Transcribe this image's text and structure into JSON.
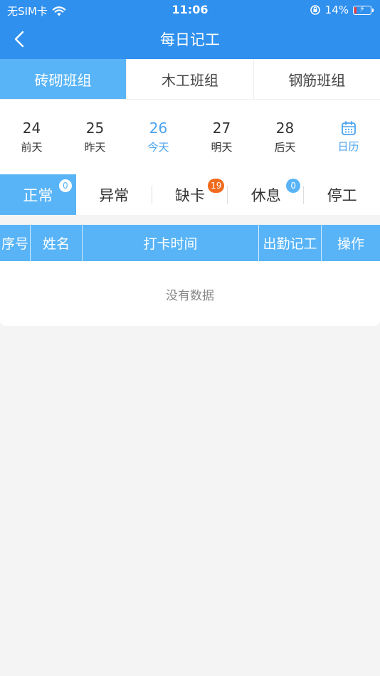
{
  "status_bar": {
    "carrier": "无SIM卡",
    "time": "11:06",
    "battery": "14%"
  },
  "nav": {
    "title": "每日记工"
  },
  "groups": [
    {
      "label": "砖砌班组",
      "active": true
    },
    {
      "label": "木工班组",
      "active": false
    },
    {
      "label": "钢筋班组",
      "active": false
    }
  ],
  "dates": [
    {
      "num": "24",
      "label": "前天"
    },
    {
      "num": "25",
      "label": "昨天"
    },
    {
      "num": "26",
      "label": "今天"
    },
    {
      "num": "27",
      "label": "明天"
    },
    {
      "num": "28",
      "label": "后天"
    }
  ],
  "calendar_label": "日历",
  "status_tabs": [
    {
      "label": "正常",
      "badge": "0"
    },
    {
      "label": "异常",
      "badge": ""
    },
    {
      "label": "缺卡",
      "badge": "19"
    },
    {
      "label": "休息",
      "badge": "0"
    },
    {
      "label": "停工",
      "badge": ""
    }
  ],
  "table": {
    "headers": [
      "序号",
      "姓名",
      "打卡时间",
      "出勤记工",
      "操作"
    ],
    "empty_text": "没有数据"
  },
  "colors": {
    "header_bg": "#2f90ee",
    "accent": "#58b4f7",
    "badge_orange": "#f26b1d"
  }
}
